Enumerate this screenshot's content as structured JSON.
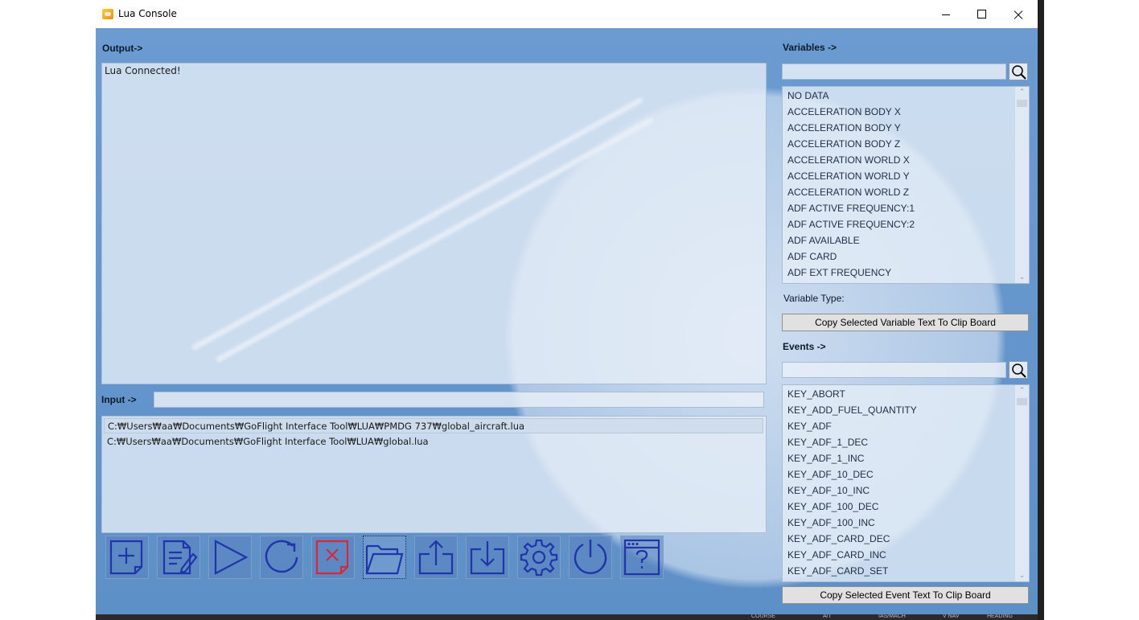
{
  "window": {
    "title": "Lua Console"
  },
  "output": {
    "label": "Output->",
    "lines": [
      "Lua Connected!"
    ]
  },
  "input": {
    "label": "Input ->",
    "value": ""
  },
  "files": [
    "C:₩Users₩aa₩Documents₩GoFlight Interface Tool₩LUA₩PMDG 737₩global_aircraft.lua",
    "C:₩Users₩aa₩Documents₩GoFlight Interface Tool₩LUA₩global.lua"
  ],
  "toolbar": [
    {
      "name": "new-file",
      "icon": "new-file-icon"
    },
    {
      "name": "edit",
      "icon": "edit-icon"
    },
    {
      "name": "run",
      "icon": "play-icon"
    },
    {
      "name": "reload",
      "icon": "reload-icon"
    },
    {
      "name": "remove",
      "icon": "remove-icon"
    },
    {
      "name": "open-folder",
      "icon": "folder-icon"
    },
    {
      "name": "export",
      "icon": "upload-icon"
    },
    {
      "name": "import",
      "icon": "download-icon"
    },
    {
      "name": "settings",
      "icon": "gear-icon"
    },
    {
      "name": "power",
      "icon": "power-icon"
    },
    {
      "name": "help",
      "icon": "help-window-icon"
    }
  ],
  "variables": {
    "label": "Variables ->",
    "search": "",
    "items": [
      " NO DATA",
      "ACCELERATION BODY X",
      "ACCELERATION BODY Y",
      "ACCELERATION BODY Z",
      "ACCELERATION WORLD X",
      "ACCELERATION WORLD Y",
      "ACCELERATION WORLD Z",
      "ADF ACTIVE FREQUENCY:1",
      "ADF ACTIVE FREQUENCY:2",
      "ADF AVAILABLE",
      "ADF CARD",
      "ADF EXT FREQUENCY"
    ],
    "type_label": "Variable Type:",
    "copy_label": "Copy Selected Variable Text To Clip Board"
  },
  "events": {
    "label": "Events ->",
    "search": "",
    "items": [
      "KEY_ABORT",
      "KEY_ADD_FUEL_QUANTITY",
      "KEY_ADF",
      "KEY_ADF_1_DEC",
      "KEY_ADF_1_INC",
      "KEY_ADF_10_DEC",
      "KEY_ADF_10_INC",
      "KEY_ADF_100_DEC",
      "KEY_ADF_100_INC",
      "KEY_ADF_CARD_DEC",
      "KEY_ADF_CARD_INC",
      "KEY_ADF_CARD_SET"
    ],
    "copy_label": "Copy Selected Event Text To Clip Board"
  },
  "background_panel_labels": [
    "COURSE",
    "A/T",
    "IAS/MACH",
    "V NAV",
    "HEADING"
  ],
  "colors": {
    "window_bg": "#6b9bd0",
    "icon_blue": "#1f35a8",
    "icon_red": "#d8283a",
    "panel_bg": "#e6eef7"
  }
}
